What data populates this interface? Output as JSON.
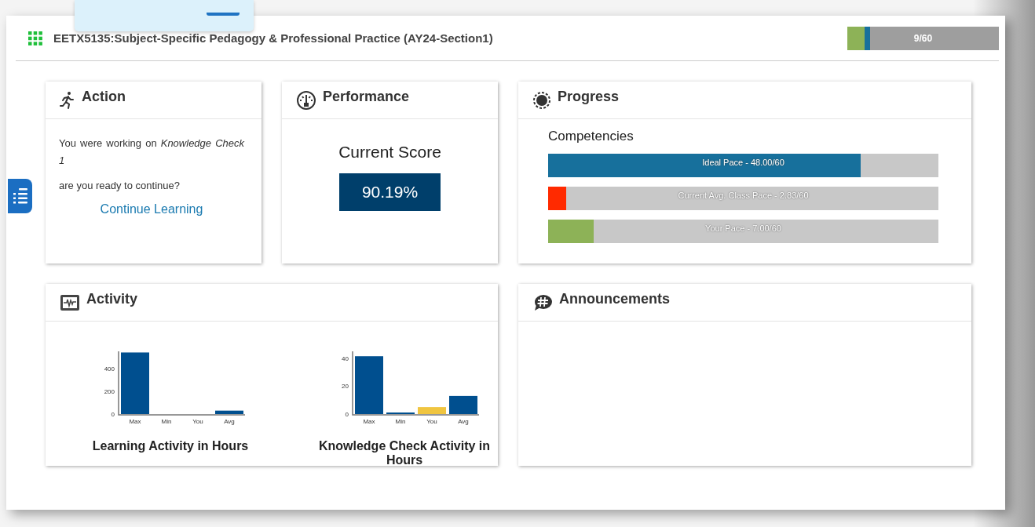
{
  "header": {
    "title": "EETX5135:Subject-Specific Pedagogy & Professional Practice (AY24-Section1)",
    "progress": {
      "label": "9/60",
      "level": 0.15
    }
  },
  "action": {
    "title": "Action",
    "message": "You were working on *Knowledge Check 1*",
    "question": "are you ready to continue?",
    "link": "Continue Learning"
  },
  "performance": {
    "title": "Performance",
    "score_label": "Current Score",
    "score": "90.19%"
  },
  "progress": {
    "title": "Progress",
    "subtitle": "Competencies",
    "bars": [
      {
        "label": "Ideal Pace - 48.00/60",
        "level": 0.8,
        "color": "#17709c"
      },
      {
        "label": "Current Avg. Class Pace - 2.83/60",
        "level": 0.047,
        "color": "#ff2a00"
      },
      {
        "label": "Your Pace - 7.00/60",
        "level": 0.117,
        "color": "#8db257"
      }
    ]
  },
  "activity": {
    "title": "Activity",
    "charts": [
      {
        "chart_data": {
          "type": "bar",
          "title": "Learning Activity in Hours",
          "categories": [
            "Max",
            "Min",
            "You",
            "Avg"
          ],
          "series": [
            {
              "color": "#004f8f",
              "values": [
                540,
                0,
                0,
                30
              ]
            }
          ],
          "ylim": [
            0,
            550
          ],
          "yticks": [
            0,
            200,
            400
          ]
        }
      },
      {
        "chart_data": {
          "type": "bar",
          "title": "Knowledge Check Activity in Hours",
          "categories": [
            "Max",
            "Min",
            "You",
            "Avg"
          ],
          "series": [
            {
              "color": "#004f8f",
              "values": [
                41.5,
                1,
                null,
                13
              ]
            },
            {
              "color": "#f0c540",
              "values": [
                null,
                null,
                5,
                null
              ]
            }
          ],
          "ylim": [
            0,
            45
          ],
          "yticks": [
            0,
            20,
            40
          ]
        }
      }
    ]
  },
  "announcements": {
    "title": "Announcements"
  }
}
